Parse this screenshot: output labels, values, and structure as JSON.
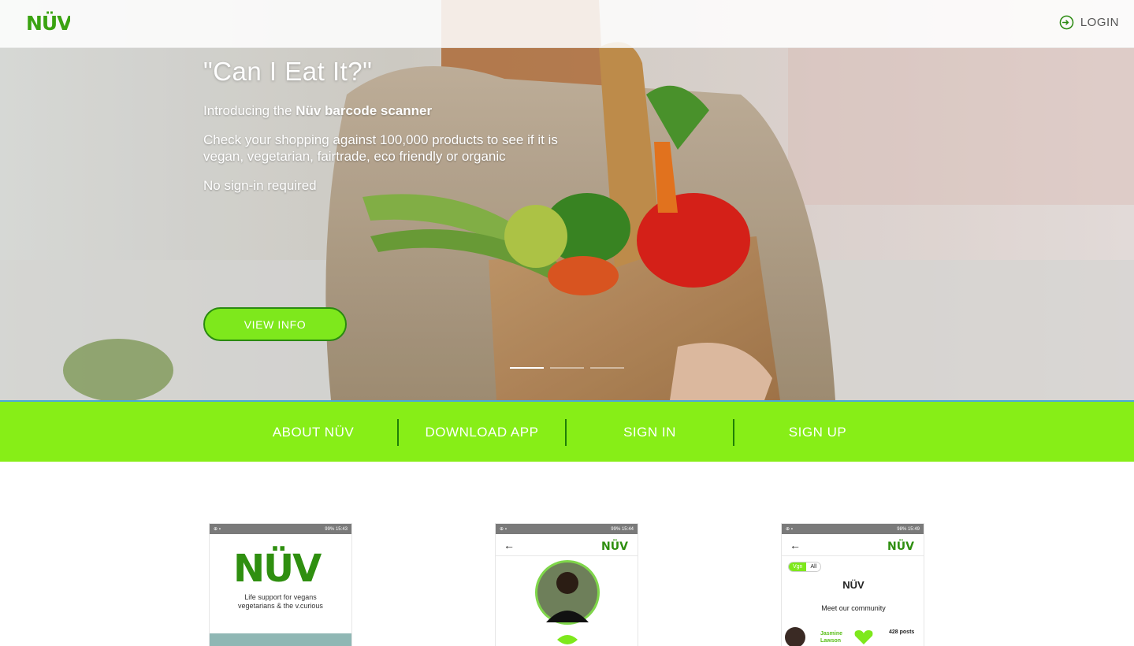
{
  "topbar": {
    "brand": "NÜV",
    "login_label": "LOGIN",
    "login_icon": "login-circle-icon"
  },
  "hero": {
    "title": "\"Can I Eat It?\"",
    "intro_prefix": "Introducing the ",
    "intro_bold": "Nüv barcode scanner",
    "check_text": "Check your shopping against 100,000 products to see if it is vegan, vegetarian, fairtrade, eco friendly or organic",
    "no_signin": "No sign-in required",
    "button_label": "VIEW INFO",
    "slides": 3,
    "active_slide": 1
  },
  "nav": {
    "items": [
      {
        "label": "ABOUT NÜV"
      },
      {
        "label": "DOWNLOAD APP"
      },
      {
        "label": "SIGN IN"
      },
      {
        "label": "SIGN UP"
      }
    ]
  },
  "phones": [
    {
      "status_right": "99% 15:43",
      "tagline_1": "Life support for vegans",
      "tagline_2": "vegetarians & the v.curious"
    },
    {
      "status_right": "99% 15:44"
    },
    {
      "status_right": "98% 15:49",
      "toggle_left": "Vgn",
      "toggle_right": "All",
      "title": "NÜV",
      "subtitle": "Meet our community",
      "user_first": "Jasmine",
      "user_last": "Lawson",
      "posts": "428 posts"
    }
  ],
  "colors": {
    "brand_green": "#87ee17",
    "dark_green": "#1f7f06"
  }
}
